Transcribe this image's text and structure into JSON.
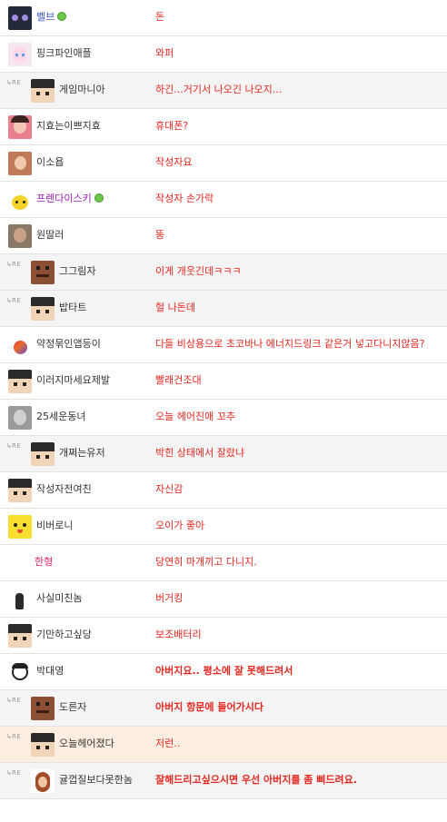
{
  "comments": [
    {
      "nick": "벨브",
      "msg": "돈",
      "reply": false,
      "avatar": "cat-avatar",
      "badge": true,
      "nick_color": "blue",
      "bold": false,
      "highlight": false
    },
    {
      "nick": "핑크파인애플",
      "msg": "와퍼",
      "reply": false,
      "avatar": "pink-hair-avatar",
      "badge": false,
      "nick_color": "default",
      "bold": false,
      "highlight": false
    },
    {
      "nick": "게임마니아",
      "msg": "하긴...거기서 나오긴 나오지...",
      "reply": true,
      "avatar": "pixel-default-avatar",
      "badge": false,
      "nick_color": "default",
      "bold": false,
      "highlight": false
    },
    {
      "nick": "지효는이쁘지효",
      "msg": "휴대폰?",
      "reply": false,
      "avatar": "girl-photo-avatar",
      "badge": false,
      "nick_color": "default",
      "bold": false,
      "highlight": false
    },
    {
      "nick": "이소욥",
      "msg": "작성자요",
      "reply": false,
      "avatar": "person-photo-avatar",
      "badge": false,
      "nick_color": "default",
      "bold": false,
      "highlight": false
    },
    {
      "nick": "프렌다이스키",
      "msg": "작성자 손가락",
      "reply": false,
      "avatar": "pikachu-avatar",
      "badge": true,
      "nick_color": "purple",
      "bold": false,
      "highlight": false
    },
    {
      "nick": "원딸러",
      "msg": "똥",
      "reply": false,
      "avatar": "man-photo-avatar",
      "badge": false,
      "nick_color": "default",
      "bold": false,
      "highlight": false
    },
    {
      "nick": "그그림자",
      "msg": "이게 개웃긴데ㅋㅋㅋ",
      "reply": true,
      "avatar": "rock-face-avatar",
      "badge": false,
      "nick_color": "default",
      "bold": false,
      "highlight": false
    },
    {
      "nick": "밥타트",
      "msg": "헐 나돈데",
      "reply": true,
      "avatar": "pixel-default-avatar",
      "badge": false,
      "nick_color": "default",
      "bold": false,
      "highlight": false
    },
    {
      "nick": "약정묶인앱등이",
      "msg": "다들 비상용으로 초코바나 에너지드링크 같은거 넣고다니지않음?",
      "reply": false,
      "avatar": "apple-logo-avatar",
      "badge": false,
      "nick_color": "default",
      "bold": false,
      "highlight": false
    },
    {
      "nick": "이러지마세요제발",
      "msg": "빨래건조대",
      "reply": false,
      "avatar": "pixel-default-avatar",
      "badge": false,
      "nick_color": "default",
      "bold": false,
      "highlight": false
    },
    {
      "nick": "25세운동녀",
      "msg": "오늘 헤어진애 꼬추",
      "reply": false,
      "avatar": "bw-photo-avatar",
      "badge": false,
      "nick_color": "default",
      "bold": false,
      "highlight": false
    },
    {
      "nick": "개쩌는유저",
      "msg": "박힌 상태에서 잘랐냐",
      "reply": true,
      "avatar": "pixel-default-avatar",
      "badge": false,
      "nick_color": "default",
      "bold": false,
      "highlight": false
    },
    {
      "nick": "작성자전여친",
      "msg": "자신감",
      "reply": false,
      "avatar": "pixel-default-avatar",
      "badge": false,
      "nick_color": "default",
      "bold": false,
      "highlight": false
    },
    {
      "nick": "비버로니",
      "msg": "오이가 좋아",
      "reply": false,
      "avatar": "yellow-face-avatar",
      "badge": false,
      "nick_color": "default",
      "bold": false,
      "highlight": false
    },
    {
      "nick": "한형",
      "msg": "당연히 마개끼고 다니지.",
      "reply": false,
      "avatar": "none",
      "badge": false,
      "nick_color": "pink",
      "bold": false,
      "highlight": false
    },
    {
      "nick": "사실미친놈",
      "msg": "버거킹",
      "reply": false,
      "avatar": "sketch-avatar",
      "badge": false,
      "nick_color": "default",
      "bold": false,
      "highlight": false
    },
    {
      "nick": "기만하고싶당",
      "msg": "보조배터리",
      "reply": false,
      "avatar": "pixel-default-avatar",
      "badge": false,
      "nick_color": "default",
      "bold": false,
      "highlight": false
    },
    {
      "nick": "박대영",
      "msg": "아버지요.. 평소에 잘 못해드려서",
      "reply": false,
      "avatar": "cartoon-face-avatar",
      "badge": false,
      "nick_color": "default",
      "bold": true,
      "highlight": false
    },
    {
      "nick": "도른자",
      "msg": "아버지 항문에 들어가시다",
      "reply": true,
      "avatar": "rock-face-avatar",
      "badge": false,
      "nick_color": "default",
      "bold": true,
      "highlight": false
    },
    {
      "nick": "오늘헤어졌다",
      "msg": "저런..",
      "reply": true,
      "avatar": "pixel-default-avatar",
      "badge": false,
      "nick_color": "default",
      "bold": false,
      "highlight": true
    },
    {
      "nick": "귤껍질보다못한놈",
      "msg": "잘해드리고싶으시면 우선 아버지를 좀 삐드려요.",
      "reply": true,
      "avatar": "mii-avatar",
      "badge": false,
      "nick_color": "default",
      "bold": true,
      "highlight": false
    }
  ],
  "reply_marker": "↳RE",
  "colors": {
    "message": "#e5261e",
    "nick_blue": "#3a55c8",
    "nick_purple": "#9a1fb5",
    "nick_pink": "#e0246a",
    "reply_bg": "#f4f4f4",
    "highlight_bg": "#fdeee2"
  }
}
